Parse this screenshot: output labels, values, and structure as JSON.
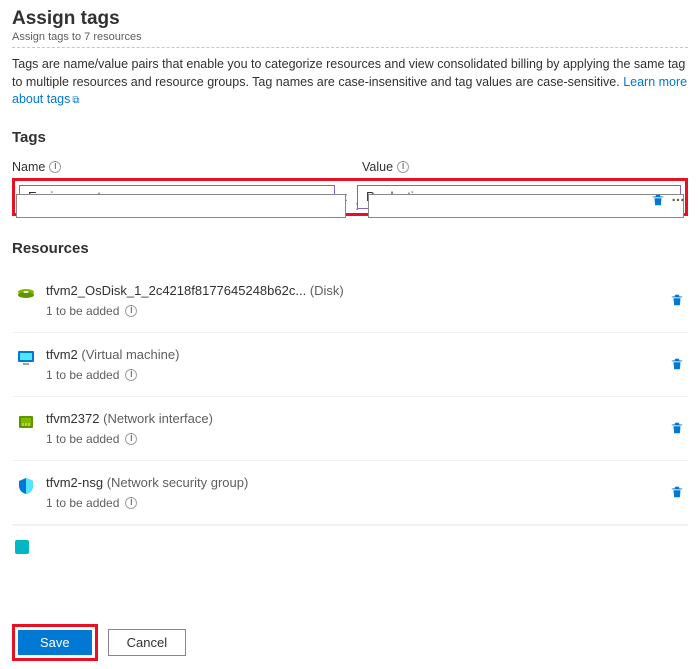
{
  "header": {
    "title": "Assign tags",
    "subtitle": "Assign tags to 7 resources",
    "description_prefix": "Tags are name/value pairs that enable you to categorize resources and view consolidated billing by applying the same tag to multiple resources and resource groups. Tag names are case-insensitive and tag values are case-sensitive. ",
    "learn_more": "Learn more about tags"
  },
  "tags": {
    "section_label": "Tags",
    "name_label": "Name",
    "value_label": "Value",
    "rows": [
      {
        "name": "Environment",
        "value": "Production",
        "filled": true
      },
      {
        "name": "",
        "value": "",
        "filled": false
      }
    ]
  },
  "resources": {
    "section_label": "Resources",
    "to_be_added_label": "1 to be added",
    "items": [
      {
        "name": "tfvm2_OsDisk_1_2c4218f8177645248b62c...",
        "type": "(Disk)",
        "icon": "disk"
      },
      {
        "name": "tfvm2",
        "type": "(Virtual machine)",
        "icon": "vm"
      },
      {
        "name": "tfvm2372",
        "type": "(Network interface)",
        "icon": "nic"
      },
      {
        "name": "tfvm2-nsg",
        "type": "(Network security group)",
        "icon": "nsg"
      }
    ]
  },
  "footer": {
    "save": "Save",
    "cancel": "Cancel"
  }
}
